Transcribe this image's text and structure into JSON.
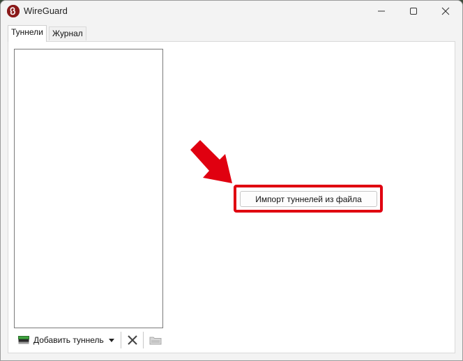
{
  "window": {
    "title": "WireGuard"
  },
  "tabs": [
    {
      "label": "Туннели",
      "selected": true
    },
    {
      "label": "Журнал",
      "selected": false
    }
  ],
  "toolbar": {
    "add_tunnel_label": "Добавить туннель",
    "icons": [
      "add-tunnel-icon",
      "chevron-down-icon",
      "delete-icon",
      "export-icon"
    ]
  },
  "main": {
    "import_button_label": "Импорт туннелей из файла"
  },
  "colors": {
    "highlight": "#e00010",
    "app_icon": "#8a1a1a"
  }
}
